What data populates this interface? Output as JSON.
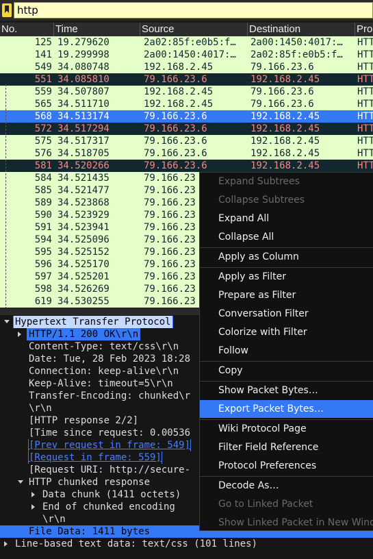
{
  "filter": {
    "value": "http"
  },
  "columns": [
    "No.",
    "Time",
    "Source",
    "Destination",
    "Pro"
  ],
  "packets": [
    {
      "no": "125",
      "time": "19.279620",
      "src": "2a02:85f:e0b5:f…",
      "dst": "2a00:1450:4017:…",
      "proto": "HTT",
      "style": "green"
    },
    {
      "no": "141",
      "time": "19.299998",
      "src": "2a00:1450:4017:…",
      "dst": "2a02:85f:e0b5:f…",
      "proto": "HTT",
      "style": "green"
    },
    {
      "no": "549",
      "time": "34.080748",
      "src": "192.168.2.45",
      "dst": "79.166.23.6",
      "proto": "HTT",
      "style": "green"
    },
    {
      "no": "551",
      "time": "34.085810",
      "src": "79.166.23.6",
      "dst": "192.168.2.45",
      "proto": "HTT",
      "style": "dark"
    },
    {
      "no": "559",
      "time": "34.507807",
      "src": "192.168.2.45",
      "dst": "79.166.23.6",
      "proto": "HTT",
      "style": "green"
    },
    {
      "no": "565",
      "time": "34.511710",
      "src": "192.168.2.45",
      "dst": "79.166.23.6",
      "proto": "HTT",
      "style": "green"
    },
    {
      "no": "568",
      "time": "34.513174",
      "src": "79.166.23.6",
      "dst": "192.168.2.45",
      "proto": "HTT",
      "style": "selected"
    },
    {
      "no": "572",
      "time": "34.517294",
      "src": "79.166.23.6",
      "dst": "192.168.2.45",
      "proto": "HTT",
      "style": "dark"
    },
    {
      "no": "575",
      "time": "34.517317",
      "src": "79.166.23.6",
      "dst": "192.168.2.45",
      "proto": "HTT",
      "style": "green"
    },
    {
      "no": "576",
      "time": "34.518705",
      "src": "79.166.23.6",
      "dst": "192.168.2.45",
      "proto": "HTT",
      "style": "green"
    },
    {
      "no": "581",
      "time": "34.520266",
      "src": "79.166.23.6",
      "dst": "192.168.2.45",
      "proto": "HTT",
      "style": "dark"
    },
    {
      "no": "584",
      "time": "34.521435",
      "src": "79.166.23",
      "dst": "",
      "proto": "",
      "style": "green"
    },
    {
      "no": "585",
      "time": "34.521477",
      "src": "79.166.23",
      "dst": "",
      "proto": "",
      "style": "green"
    },
    {
      "no": "589",
      "time": "34.523868",
      "src": "79.166.23",
      "dst": "",
      "proto": "",
      "style": "green"
    },
    {
      "no": "590",
      "time": "34.523929",
      "src": "79.166.23",
      "dst": "",
      "proto": "",
      "style": "green"
    },
    {
      "no": "591",
      "time": "34.523941",
      "src": "79.166.23",
      "dst": "",
      "proto": "",
      "style": "green"
    },
    {
      "no": "594",
      "time": "34.525096",
      "src": "79.166.23",
      "dst": "",
      "proto": "",
      "style": "green"
    },
    {
      "no": "595",
      "time": "34.525152",
      "src": "79.166.23",
      "dst": "",
      "proto": "",
      "style": "green"
    },
    {
      "no": "596",
      "time": "34.525170",
      "src": "79.166.23",
      "dst": "",
      "proto": "",
      "style": "green"
    },
    {
      "no": "597",
      "time": "34.525201",
      "src": "79.166.23",
      "dst": "",
      "proto": "",
      "style": "green"
    },
    {
      "no": "598",
      "time": "34.526269",
      "src": "79.166.23",
      "dst": "",
      "proto": "",
      "style": "green"
    },
    {
      "no": "619",
      "time": "34.530255",
      "src": "79.166.23",
      "dst": "",
      "proto": "",
      "style": "green"
    }
  ],
  "details": [
    {
      "text": "Hypertext Transfer Protocol",
      "indent": 0,
      "arrow": "down",
      "style": "outlined"
    },
    {
      "text": "HTTP/1.1 200 OK\\r\\n",
      "indent": 1,
      "arrow": "right",
      "style": "outlined"
    },
    {
      "text": "Content-Type: text/css\\r\\n",
      "indent": 1,
      "arrow": "",
      "style": ""
    },
    {
      "text": "Date: Tue, 28 Feb 2023 18:28",
      "indent": 1,
      "arrow": "",
      "style": ""
    },
    {
      "text": "Connection: keep-alive\\r\\n",
      "indent": 1,
      "arrow": "",
      "style": ""
    },
    {
      "text": "Keep-Alive: timeout=5\\r\\n",
      "indent": 1,
      "arrow": "",
      "style": ""
    },
    {
      "text": "Transfer-Encoding: chunked\\r",
      "indent": 1,
      "arrow": "",
      "style": ""
    },
    {
      "text": "\\r\\n",
      "indent": 1,
      "arrow": "",
      "style": ""
    },
    {
      "text": "[HTTP response 2/2]",
      "indent": 1,
      "arrow": "",
      "style": ""
    },
    {
      "text": "[Time since request: 0.00536",
      "indent": 1,
      "arrow": "",
      "style": ""
    },
    {
      "text": "[Prev request in frame: 549]",
      "indent": 1,
      "arrow": "",
      "style": "link"
    },
    {
      "text": "[Request in frame: 559]",
      "indent": 1,
      "arrow": "",
      "style": "link"
    },
    {
      "text": "[Request URI: http://secure-",
      "indent": 1,
      "arrow": "",
      "style": ""
    },
    {
      "text": "HTTP chunked response",
      "indent": 1,
      "arrow": "down",
      "style": ""
    },
    {
      "text": "Data chunk (1411 octets)",
      "indent": 2,
      "arrow": "right",
      "style": ""
    },
    {
      "text": "End of chunked encoding",
      "indent": 2,
      "arrow": "right",
      "style": ""
    },
    {
      "text": "\\r\\n",
      "indent": 2,
      "arrow": "",
      "style": ""
    },
    {
      "text": "File Data: 1411 bytes",
      "indent": 1,
      "arrow": "",
      "style": "selected"
    },
    {
      "text": "Line-based text data: text/css (101 lines)",
      "indent": 0,
      "arrow": "right",
      "style": ""
    }
  ],
  "context_menu": [
    {
      "label": "Expand Subtrees",
      "disabled": true
    },
    {
      "label": "Collapse Subtrees",
      "disabled": true
    },
    {
      "label": "Expand All",
      "disabled": false
    },
    {
      "label": "Collapse All",
      "disabled": false,
      "sep_after": true
    },
    {
      "label": "Apply as Column",
      "disabled": false,
      "sep_after": true
    },
    {
      "label": "Apply as Filter",
      "disabled": false
    },
    {
      "label": "Prepare as Filter",
      "disabled": false
    },
    {
      "label": "Conversation Filter",
      "disabled": false
    },
    {
      "label": "Colorize with Filter",
      "disabled": false
    },
    {
      "label": "Follow",
      "disabled": false,
      "sep_after": true
    },
    {
      "label": "Copy",
      "disabled": false,
      "sep_after": true
    },
    {
      "label": "Show Packet Bytes…",
      "disabled": false
    },
    {
      "label": "Export Packet Bytes…",
      "disabled": false,
      "highlighted": true,
      "sep_after": true
    },
    {
      "label": "Wiki Protocol Page",
      "disabled": false
    },
    {
      "label": "Filter Field Reference",
      "disabled": false
    },
    {
      "label": "Protocol Preferences",
      "disabled": false,
      "sep_after": true
    },
    {
      "label": "Decode As…",
      "disabled": false
    },
    {
      "label": "Go to Linked Packet",
      "disabled": true
    },
    {
      "label": "Show Linked Packet in New Window",
      "disabled": true
    }
  ],
  "colors": {
    "green_row": "#e4ffc7",
    "dark_row": "#12272e",
    "selected": "#3478f6",
    "dark_row_text": "#f78787"
  }
}
